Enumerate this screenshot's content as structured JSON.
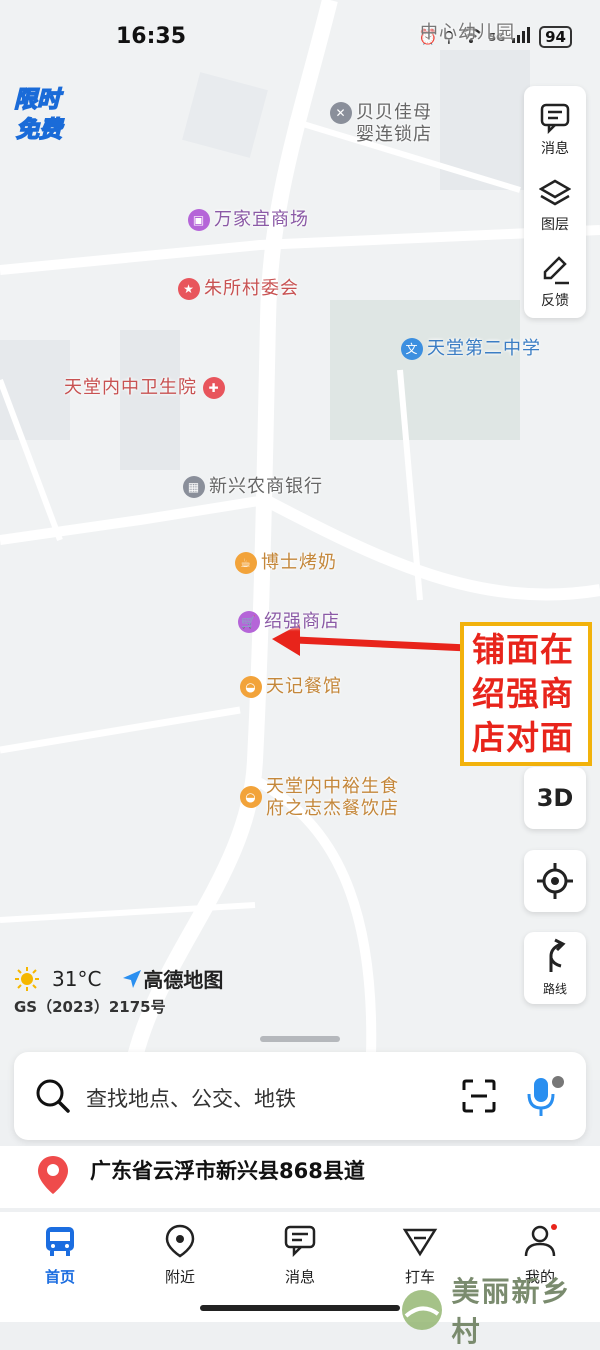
{
  "status_bar": {
    "time": "16:35",
    "network": "5G",
    "battery": "94"
  },
  "promo": {
    "line1": "限时",
    "line2": "免费"
  },
  "right_panel": {
    "messages": "消息",
    "layers": "图层",
    "feedback": "反馈"
  },
  "map": {
    "top_label": "中心幼儿园",
    "pois": [
      {
        "name": "贝贝佳母婴连锁店",
        "line1": "贝贝佳母",
        "line2": "婴连锁店",
        "color": "#8a8f9a"
      },
      {
        "name": "万家宜商场",
        "color": "#b565d8"
      },
      {
        "name": "朱所村委会",
        "color": "#e8555c"
      },
      {
        "name": "天堂第二中学",
        "color": "#3c8fe0"
      },
      {
        "name": "天堂内中卫生院",
        "color": "#e8555c"
      },
      {
        "name": "新兴农商银行",
        "color": "#8a8f9a"
      },
      {
        "name": "博士烤奶",
        "color": "#f2a33a"
      },
      {
        "name": "绍强商店",
        "color": "#b565d8"
      },
      {
        "name": "天记餐馆",
        "color": "#f2a33a"
      },
      {
        "name": "天堂内中裕生食府之志杰餐饮店",
        "line1": "天堂内中裕生食",
        "line2": "府之志杰餐饮店",
        "color": "#f2a33a"
      }
    ]
  },
  "annotation": {
    "line1": "铺面在",
    "line2": "绍强商",
    "line3": "店对面"
  },
  "controls": {
    "three_d": "3D",
    "route": "路线"
  },
  "weather": {
    "temperature": "31°C",
    "brand": "高德地图",
    "license": "GS（2023）2175号"
  },
  "search": {
    "placeholder": "查找地点、公交、地铁"
  },
  "location": {
    "address": "广东省云浮市新兴县868县道"
  },
  "tabs": [
    {
      "label": "首页",
      "active": true
    },
    {
      "label": "附近"
    },
    {
      "label": "消息"
    },
    {
      "label": "打车"
    },
    {
      "label": "我的"
    }
  ],
  "watermark": {
    "text": "美丽新乡村"
  },
  "colors": {
    "accent": "#1b6de0",
    "annotation_red": "#e8241b",
    "annotation_border": "#f2b20c"
  }
}
